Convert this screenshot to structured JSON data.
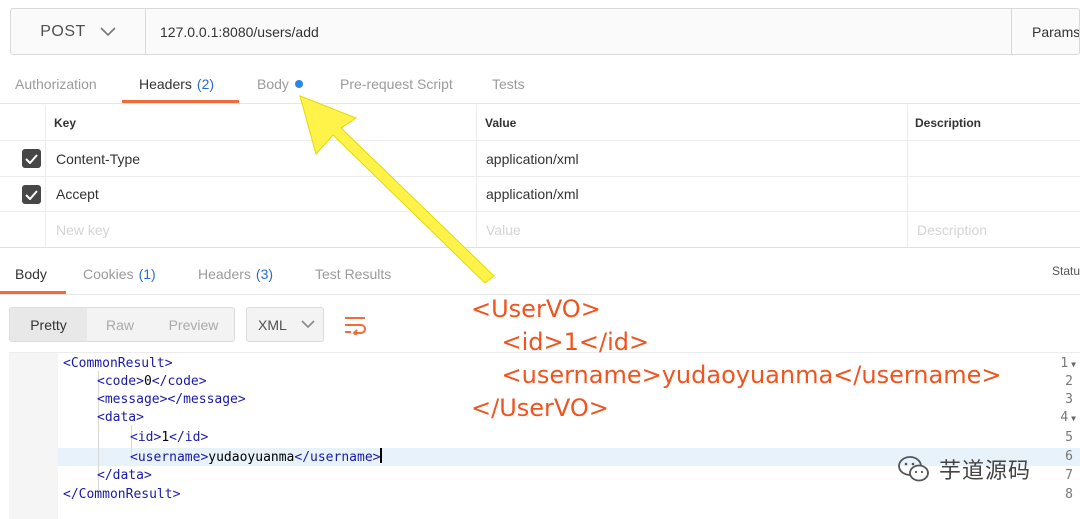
{
  "request": {
    "method": "POST",
    "url": "127.0.0.1:8080/users/add",
    "params_label": "Params"
  },
  "request_tabs": [
    {
      "label": "Authorization",
      "count": ""
    },
    {
      "label": "Headers",
      "count": "(2)"
    },
    {
      "label": "Body",
      "count": ""
    },
    {
      "label": "Pre-request Script",
      "count": ""
    },
    {
      "label": "Tests",
      "count": ""
    }
  ],
  "headers_table": {
    "columns": [
      "Key",
      "Value",
      "Description"
    ],
    "rows": [
      {
        "key": "Content-Type",
        "value": "application/xml",
        "description": "",
        "checked": true
      },
      {
        "key": "Accept",
        "value": "application/xml",
        "description": "",
        "checked": true
      }
    ],
    "placeholders": {
      "key": "New key",
      "value": "Value",
      "description": "Description"
    }
  },
  "response_tabs": [
    {
      "label": "Body",
      "count": ""
    },
    {
      "label": "Cookies",
      "count": "(1)"
    },
    {
      "label": "Headers",
      "count": "(3)"
    },
    {
      "label": "Test Results",
      "count": ""
    }
  ],
  "status_label": "Status",
  "view_modes": [
    "Pretty",
    "Raw",
    "Preview"
  ],
  "format": "XML",
  "code_lines": [
    {
      "num": "1",
      "fold": true
    },
    {
      "num": "2",
      "fold": false
    },
    {
      "num": "3",
      "fold": false
    },
    {
      "num": "4",
      "fold": true
    },
    {
      "num": "5",
      "fold": false
    },
    {
      "num": "6",
      "fold": false
    },
    {
      "num": "7",
      "fold": false
    },
    {
      "num": "8",
      "fold": false
    }
  ],
  "code": {
    "l1_open": "<CommonResult>",
    "l2_open": "<code>",
    "l2_text": "0",
    "l2_close": "</code>",
    "l3_tag": "<message></message>",
    "l4_open": "<data>",
    "l5_open": "<id>",
    "l5_text": "1",
    "l5_close": "</id>",
    "l6_open": "<username>",
    "l6_text": "yudaoyuanma",
    "l6_close": "</username>",
    "l7_close": "</data>",
    "l8_close": "</CommonResult>"
  },
  "annotation": {
    "line1": "<UserVO>",
    "line2": "    <id>1</id>",
    "line3": "    <username>yudaoyuanma</username>",
    "line4": "</UserVO>"
  },
  "watermark": "芋道源码",
  "colors": {
    "accent": "#f26b3a",
    "count_blue": "#2a6dd2",
    "annotation": "#f0541e",
    "arrow": "#fff34a"
  }
}
